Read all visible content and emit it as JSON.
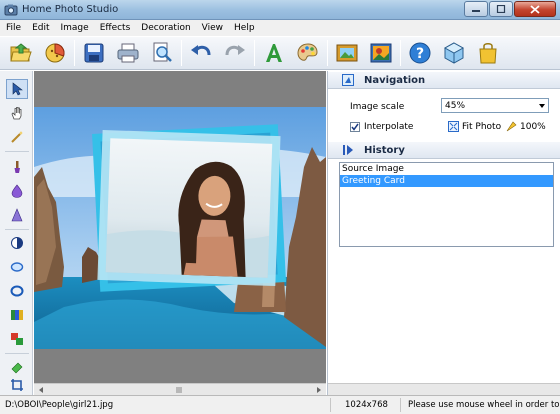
{
  "window": {
    "title": "Home Photo Studio",
    "icon": "app-camera-icon"
  },
  "menu": {
    "items": [
      "File",
      "Edit",
      "Image",
      "Effects",
      "Decoration",
      "View",
      "Help"
    ]
  },
  "toolbar": {
    "buttons": [
      "open-folder-icon",
      "pie-chart-icon",
      "save-icon",
      "print-icon",
      "print-preview-icon",
      "undo-icon",
      "redo-icon",
      "text-icon",
      "palette-icon",
      "frame-icon",
      "photo-effect-icon",
      "help-icon",
      "cube-icon",
      "bag-icon"
    ]
  },
  "left_tools": [
    "pointer-icon",
    "hand-icon",
    "magic-wand-icon",
    "brush-icon",
    "drop-icon",
    "cone-icon",
    "contrast-icon",
    "ellipse-icon",
    "ring-icon",
    "gradient-icon",
    "color-swap-icon",
    "eraser-icon",
    "crop-icon"
  ],
  "navigation": {
    "title": "Navigation",
    "image_scale_label": "Image scale",
    "image_scale_value": "45%",
    "interpolate_label": "Interpolate",
    "interpolate_checked": true,
    "fit_photo_label": "Fit Photo",
    "zoom100_label": "100%"
  },
  "history": {
    "title": "History",
    "items": [
      "Source Image",
      "Greeting Card"
    ],
    "selected_index": 1
  },
  "status": {
    "path": "D:\\OBOI\\People\\girl21.jpg",
    "dimensions": "1024x768",
    "message": "Please use mouse wheel in order to s"
  },
  "colors": {
    "accent": "#3399ff",
    "title_bar": "#9bbfe0",
    "canvas_bg": "#808080",
    "frame_cyan": "#35c0e8"
  }
}
